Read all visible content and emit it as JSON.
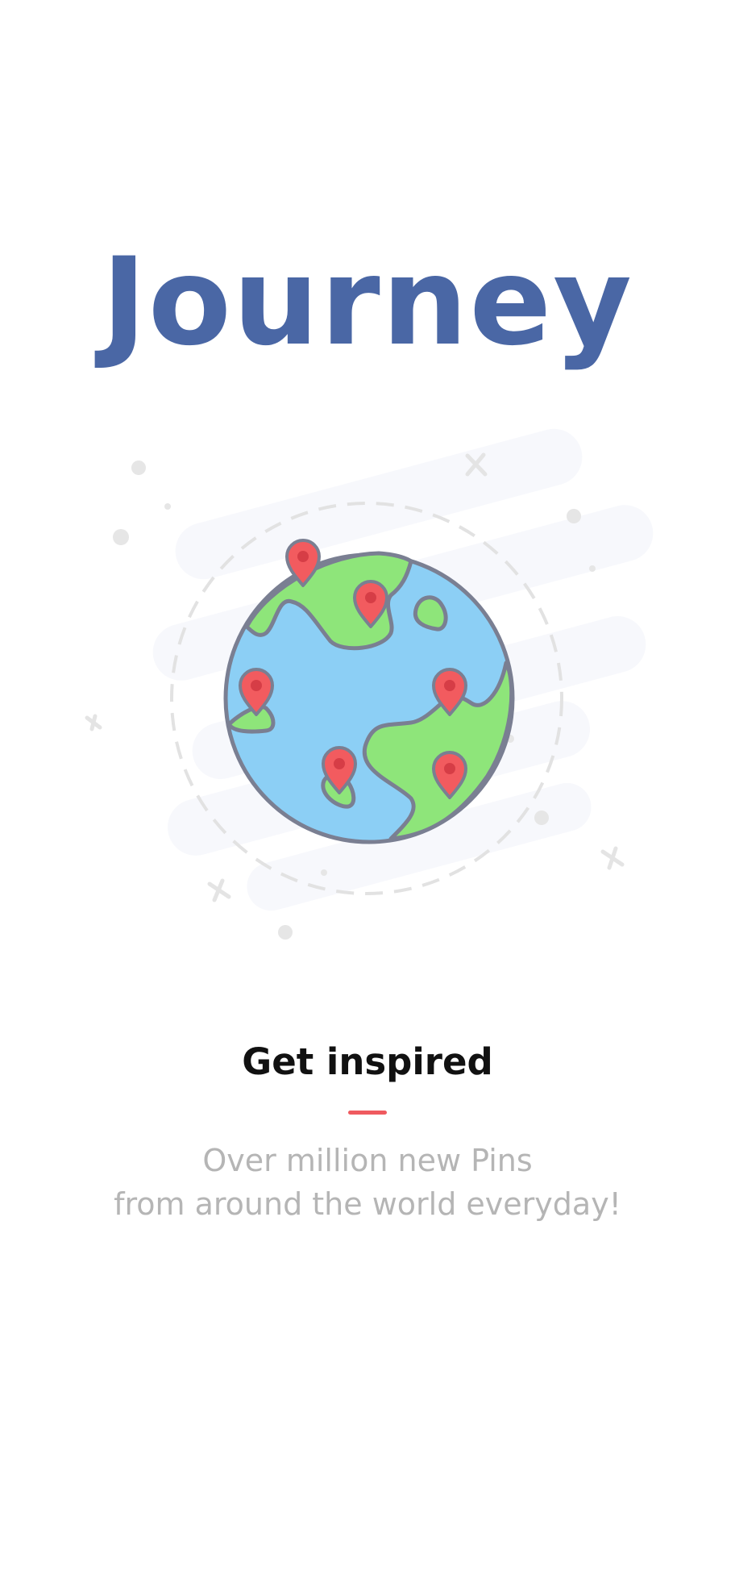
{
  "app": {
    "title": "Journey"
  },
  "illustration": {
    "icon": "globe-with-location-pins-icon",
    "pin_icon": "map-pin-icon",
    "pin_count": 6,
    "colors": {
      "ocean": "#8ccff5",
      "land": "#8ee57a",
      "outline": "#7a7f92",
      "pin": "#f25b5f",
      "pin_dot": "#d63d46",
      "cloud": "#f7f8fc",
      "sparkle": "#e6e6e6"
    }
  },
  "onboarding": {
    "headline": "Get inspired",
    "subtitle_line_1": "Over million new Pins",
    "subtitle_line_2": "from around the world everyday!"
  },
  "colors": {
    "title": "#4a67a5",
    "accent": "#ef5a5f",
    "headline": "#111111",
    "subtitle": "#b5b5b5"
  }
}
